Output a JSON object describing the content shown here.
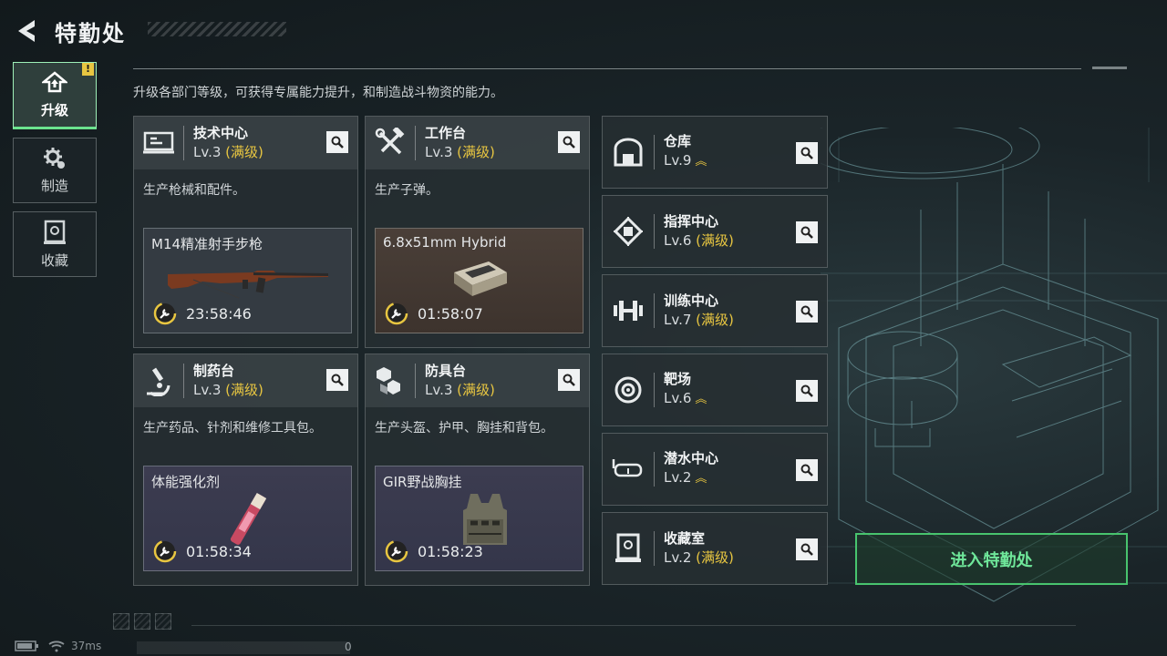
{
  "header": {
    "title": "特勤处"
  },
  "subtitle": "升级各部门等级，可获得专属能力提升，和制造战斗物资的能力。",
  "nav": [
    {
      "label": "升级",
      "icon": "upgrade-icon",
      "active": true,
      "badge": "!"
    },
    {
      "label": "制造",
      "icon": "gear-icon",
      "active": false
    },
    {
      "label": "收藏",
      "icon": "collection-icon",
      "active": false
    }
  ],
  "cards": [
    {
      "name": "技术中心",
      "level": "Lv.3",
      "status": "(满级)",
      "desc": "生产枪械和配件。",
      "product": "M14精准射手步枪",
      "timer": "23:58:46"
    },
    {
      "name": "工作台",
      "level": "Lv.3",
      "status": "(满级)",
      "desc": "生产子弹。",
      "product": "6.8x51mm Hybrid",
      "timer": "01:58:07"
    },
    {
      "name": "制药台",
      "level": "Lv.3",
      "status": "(满级)",
      "desc": "生产药品、针剂和维修工具包。",
      "product": "体能强化剂",
      "timer": "01:58:34"
    },
    {
      "name": "防具台",
      "level": "Lv.3",
      "status": "(满级)",
      "desc": "生产头盔、护甲、胸挂和背包。",
      "product": "GIR野战胸挂",
      "timer": "01:58:23"
    }
  ],
  "mini_cards": [
    {
      "name": "仓库",
      "level": "Lv.9",
      "status": "",
      "upgradable": true
    },
    {
      "name": "指挥中心",
      "level": "Lv.6",
      "status": "(满级)",
      "upgradable": false
    },
    {
      "name": "训练中心",
      "level": "Lv.7",
      "status": "(满级)",
      "upgradable": false
    },
    {
      "name": "靶场",
      "level": "Lv.6",
      "status": "",
      "upgradable": true
    },
    {
      "name": "潜水中心",
      "level": "Lv.2",
      "status": "",
      "upgradable": true
    },
    {
      "name": "收藏室",
      "level": "Lv.2",
      "status": "(满级)",
      "upgradable": false
    }
  ],
  "enter_button": "进入特勤处",
  "status": {
    "ping": "37ms",
    "counter": "0"
  },
  "colors": {
    "accent": "#6be38e",
    "maxed": "#e8c641",
    "enter": "#6fe79a"
  }
}
